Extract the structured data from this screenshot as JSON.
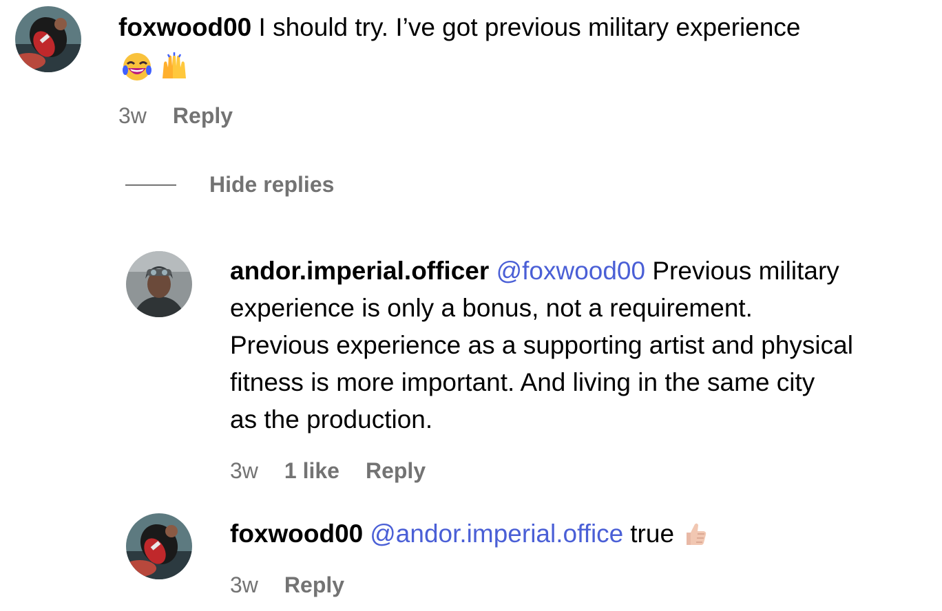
{
  "comments": [
    {
      "username": "foxwood00",
      "text": "I should try. I’ve got previous military experience",
      "emojis": [
        "laughing-tears-emoji",
        "raised-hands-emoji"
      ],
      "time": "3w",
      "reply_label": "Reply"
    }
  ],
  "replies_toggle": {
    "label": "Hide replies"
  },
  "replies": [
    {
      "username": "andor.imperial.officer",
      "mention": "@foxwood00",
      "line1_text": "Previous military",
      "lines": [
        "experience is only a bonus, not a requirement.",
        "Previous experience as a supporting artist and physical",
        "fitness is more important. And living in the same city",
        "as the production."
      ],
      "time": "3w",
      "likes": "1 like",
      "reply_label": "Reply"
    },
    {
      "username": "foxwood00",
      "mention": "@andor.imperial.office",
      "text": "true",
      "emoji": "thumbs-up-emoji",
      "time": "3w",
      "reply_label": "Reply"
    }
  ]
}
